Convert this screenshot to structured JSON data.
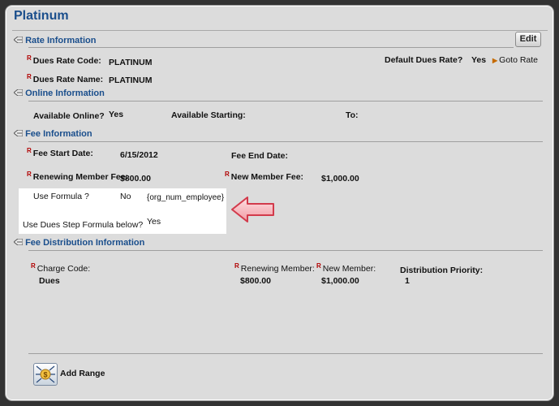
{
  "title": "Platinum",
  "rate_info": {
    "header": "Rate Information",
    "edit_label": "Edit",
    "code_label": "Dues Rate Code:",
    "code_value": "PLATINUM",
    "name_label": "Dues Rate Name:",
    "name_value": "PLATINUM",
    "default_label": "Default Dues Rate?",
    "default_value": "Yes",
    "goto_label": "Goto Rate",
    "required_marker": "R"
  },
  "online_info": {
    "header": "Online Information",
    "available_label": "Available Online?",
    "available_value": "Yes",
    "starting_label": "Available Starting:",
    "to_label": "To:"
  },
  "fee_info": {
    "header": "Fee Information",
    "start_label": "Fee Start Date:",
    "start_value": "6/15/2012",
    "end_label": "Fee End Date:",
    "renewing_label": "Renewing Member Fee:",
    "renewing_value": "$800.00",
    "new_label": "New Member Fee:",
    "new_value": "$1,000.00",
    "formula_label": "Use Formula ?",
    "formula_value": "No",
    "formula_expr": "{org_num_employee}",
    "step_label": "Use Dues Step Formula below?",
    "step_value": "Yes"
  },
  "fee_dist": {
    "header": "Fee Distribution Information",
    "charge_label": "Charge Code:",
    "charge_value": "Dues",
    "renewing_label": "Renewing Member:",
    "renewing_value": "$800.00",
    "new_label": "New Member:",
    "new_value": "$1,000.00",
    "priority_label": "Distribution Priority:",
    "priority_value": "1"
  },
  "add_range_label": "Add Range",
  "colors": {
    "section_blue": "#1a4e8c",
    "required_red": "#b00000",
    "callout_pink": "#f29aa3"
  }
}
